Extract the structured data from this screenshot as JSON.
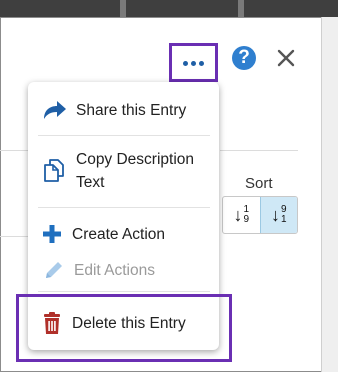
{
  "header": {
    "more_icon": "ellipsis-icon",
    "help_label": "?",
    "help_icon": "help-circle-icon",
    "close_icon": "close-icon"
  },
  "sort": {
    "label": "Sort",
    "ascending": {
      "top": "1",
      "bottom": "9",
      "icon": "sort-ascending-icon"
    },
    "descending": {
      "top": "9",
      "bottom": "1",
      "icon": "sort-descending-icon",
      "selected": true
    }
  },
  "menu": {
    "items": [
      {
        "label": "Share this Entry",
        "icon": "share-icon",
        "enabled": true,
        "color": "#1f5fa6"
      },
      {
        "label": "Copy Description",
        "label_line2": "Text",
        "icon": "copy-icon",
        "enabled": true,
        "color": "#1f5fa6"
      },
      {
        "label": "Create Action",
        "icon": "plus-icon",
        "enabled": true,
        "color": "#1f6fbf"
      },
      {
        "label": "Edit Actions",
        "icon": "pencil-icon",
        "enabled": false,
        "color": "#9cc2e6"
      },
      {
        "label": "Delete this Entry",
        "icon": "trash-icon",
        "enabled": true,
        "color": "#c0392b"
      }
    ]
  },
  "colors": {
    "highlight": "#6a2fb3",
    "accent": "#1f5fa6",
    "sort_active_bg": "#cfe8f6"
  }
}
